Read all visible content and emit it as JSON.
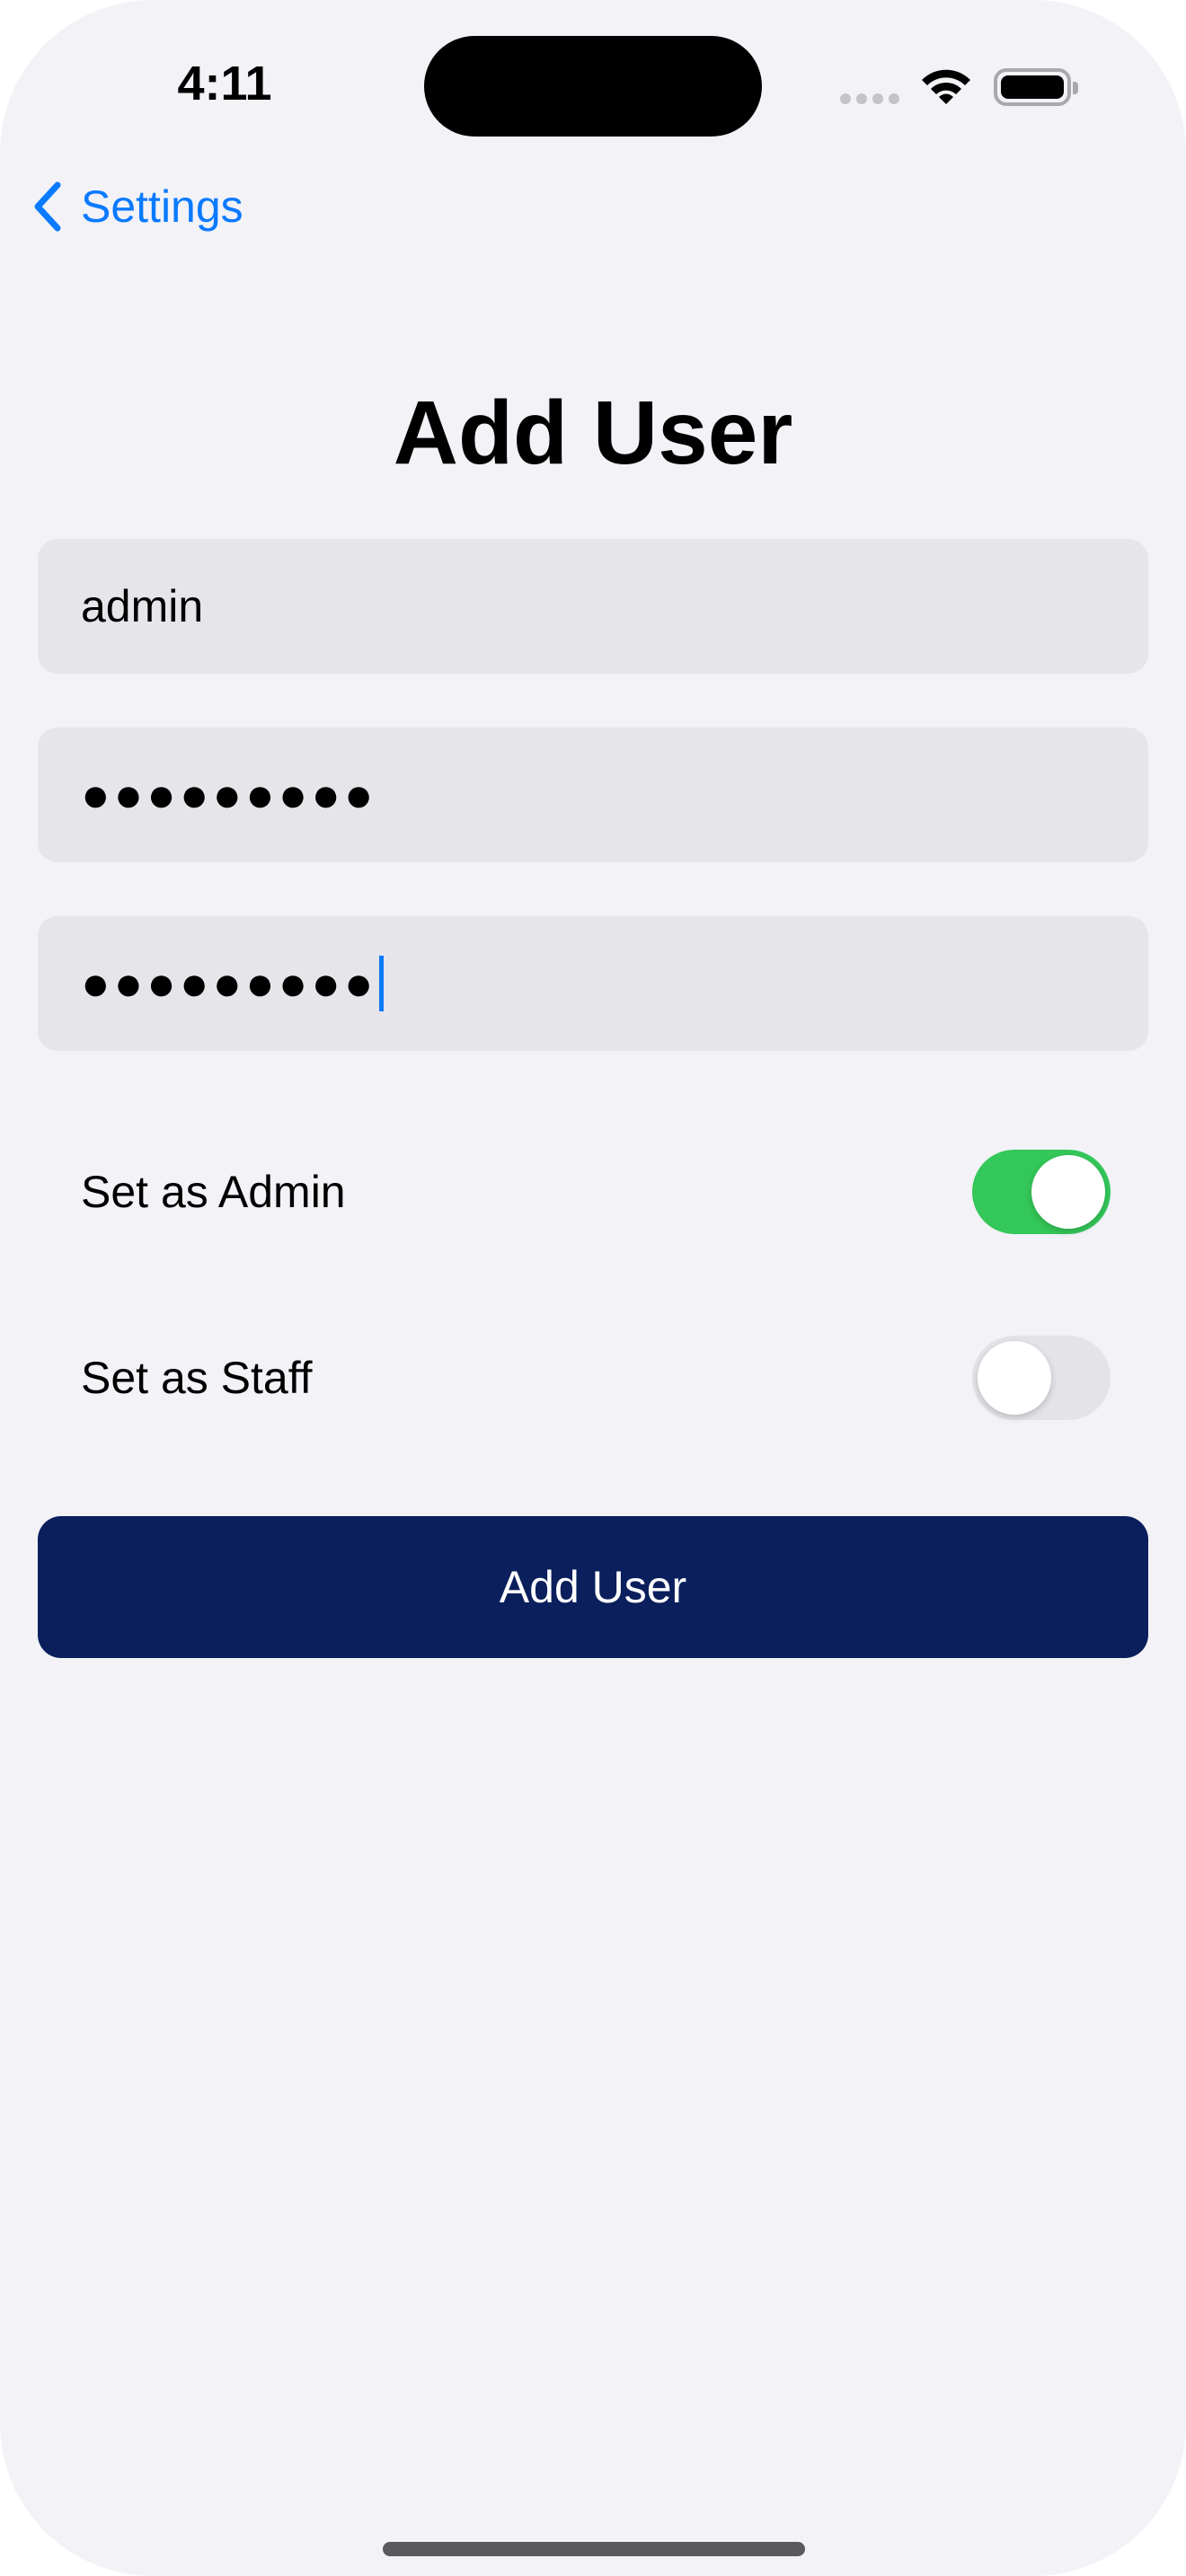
{
  "status_bar": {
    "time": "4:11"
  },
  "nav": {
    "back_label": "Settings",
    "title": "Add User"
  },
  "form": {
    "username_value": "admin",
    "password_value": "●●●●●●●●●",
    "confirm_password_value": "●●●●●●●●●",
    "toggles": [
      {
        "label": "Set as Admin",
        "state": "on"
      },
      {
        "label": "Set as Staff",
        "state": "off"
      }
    ],
    "submit_label": "Add User"
  },
  "colors": {
    "accent": "#0A7AFF",
    "toggle_on": "#34C759",
    "button_bg": "#0A1F5C",
    "background": "#F2F2F7",
    "field_bg": "#E5E5EA"
  }
}
